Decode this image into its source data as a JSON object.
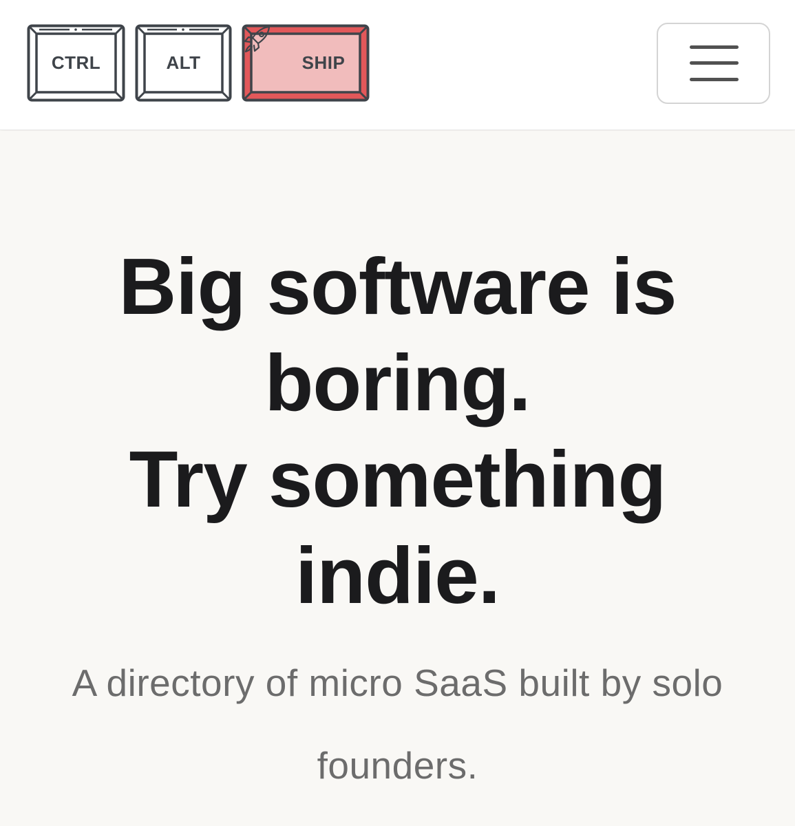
{
  "header": {
    "logo": {
      "keys": [
        {
          "label": "CTRL"
        },
        {
          "label": "ALT"
        },
        {
          "label": "SHIP"
        }
      ],
      "rocket_icon": "rocket-icon"
    },
    "menu_icon": "hamburger-icon"
  },
  "hero": {
    "headline_lines": [
      "Big software is",
      "boring.",
      "Try something",
      "indie."
    ],
    "subtitle": "A directory of micro SaaS built by solo founders."
  },
  "colors": {
    "header_bg": "#ffffff",
    "page_bg": "#f9f8f5",
    "keycap_stroke": "#3f444a",
    "ship_key_fill": "#f1bcbc",
    "ship_key_border": "#e2585a",
    "headline": "#1b1b1d",
    "subtitle": "#6c6c6c"
  }
}
